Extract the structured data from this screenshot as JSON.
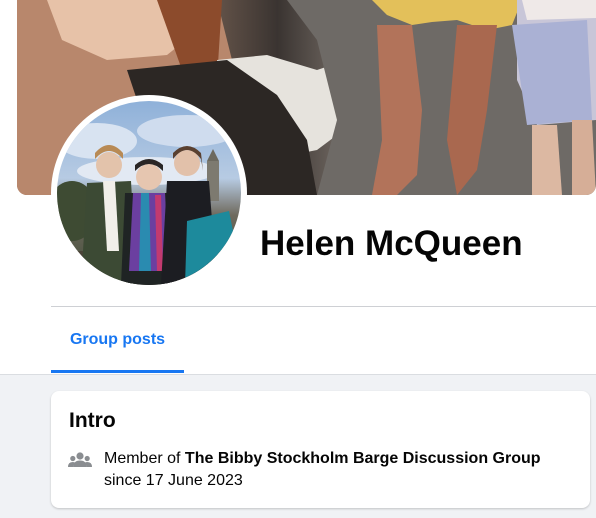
{
  "profile": {
    "name": "Helen McQueen"
  },
  "tabs": [
    {
      "label": "Group posts"
    }
  ],
  "intro": {
    "title": "Intro",
    "member_prefix": "Member of",
    "group_name": "The Bibby Stockholm Barge Discussion Group",
    "since": "since 17 June 2023",
    "icon": "group-icon"
  },
  "colors": {
    "accent": "#1877f2",
    "background": "#f0f2f5",
    "text": "#050505"
  }
}
